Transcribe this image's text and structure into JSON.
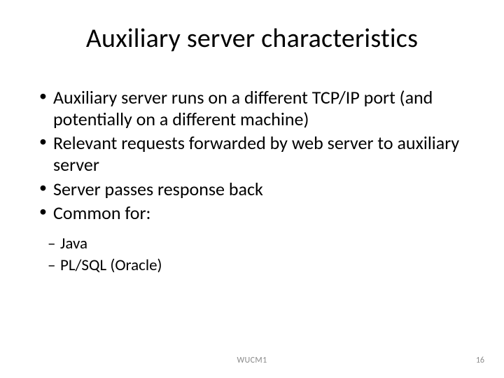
{
  "title": "Auxiliary server characteristics",
  "bullets": [
    "Auxiliary server runs on a different TCP/IP port (and potentially on a different machine)",
    "Relevant requests forwarded by web server to auxiliary server",
    "Server passes response back",
    "Common for:"
  ],
  "sub_bullets": [
    "Java",
    "PL/SQL (Oracle)"
  ],
  "footer_label": "WUCM1",
  "page_number": "16"
}
